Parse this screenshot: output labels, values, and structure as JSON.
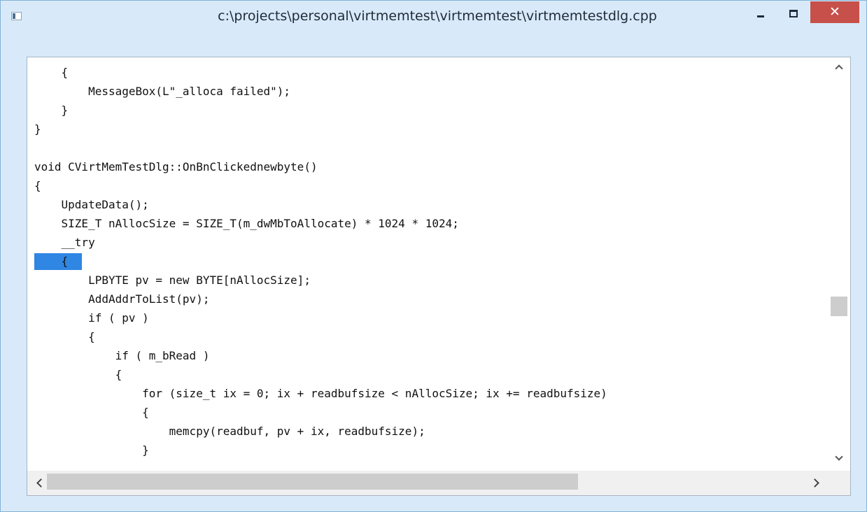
{
  "window": {
    "title": "c:\\projects\\personal\\virtmemtest\\virtmemtest\\virtmemtestdlg.cpp",
    "app_icon": "window-app-icon",
    "controls": {
      "minimize": "minimize-icon",
      "maximize": "maximize-icon",
      "close_glyph": "✕"
    }
  },
  "code": {
    "lines": [
      "    {",
      "        MessageBox(L\"_alloca failed\");",
      "    }",
      "}",
      "",
      "void CVirtMemTestDlg::OnBnClickednewbyte()",
      "{",
      "    UpdateData();",
      "    SIZE_T nAllocSize = SIZE_T(m_dwMbToAllocate) * 1024 * 1024;",
      "    __try",
      "    {",
      "        LPBYTE pv = new BYTE[nAllocSize];",
      "        AddAddrToList(pv);",
      "        if ( pv )",
      "        {",
      "            if ( m_bRead )",
      "            {",
      "                for (size_t ix = 0; ix + readbufsize < nAllocSize; ix += readbufsize)",
      "                {",
      "                    memcpy(readbuf, pv + ix, readbufsize);",
      "                }"
    ],
    "selection": {
      "line_number": 11,
      "color": "#2f86e3"
    }
  },
  "scrollbars": {
    "vertical": {
      "position_fraction": 0.62
    },
    "horizontal": {
      "visible_fraction": 0.7
    }
  },
  "colors": {
    "frame": "#d8eafa",
    "close_button": "#c7504b",
    "selection": "#2f86e3"
  }
}
